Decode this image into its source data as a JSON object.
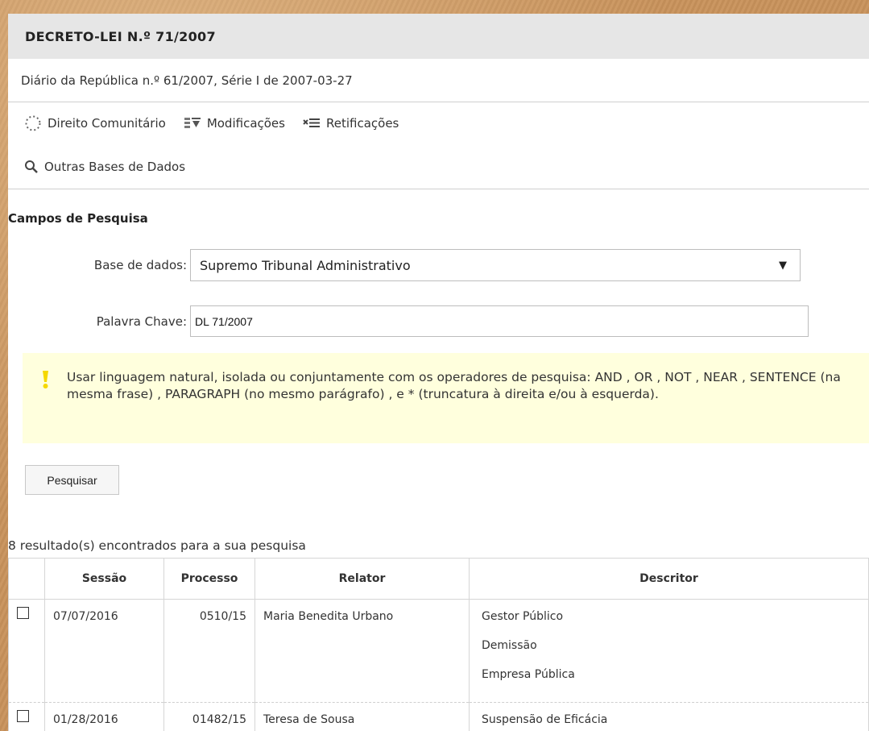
{
  "header": {
    "title": "DECRETO-LEI N.º 71/2007",
    "subtitle": "Diário da República n.º 61/2007, Série I de 2007-03-27"
  },
  "links": {
    "direito_comunitario": "Direito Comunitário",
    "modificacoes": "Modificações",
    "retificacoes": "Retificações",
    "outras_bases": "Outras Bases de Dados"
  },
  "search": {
    "section_title": "Campos de Pesquisa",
    "database_label": "Base de dados:",
    "database_value": "Supremo Tribunal Administrativo",
    "keyword_label": "Palavra Chave:",
    "keyword_value": "DL 71/2007",
    "notice_text": "Usar linguagem natural, isolada ou conjuntamente com os operadores de pesquisa: AND , OR , NOT , NEAR , SENTENCE (na mesma frase) , PARAGRAPH (no mesmo parágrafo) , e * (truncatura à direita e/ou à esquerda).",
    "button_label": "Pesquisar"
  },
  "results": {
    "count_text": "8 resultado(s) encontrados para a sua pesquisa",
    "columns": [
      "Sessão",
      "Processo",
      "Relator",
      "Descritor"
    ],
    "rows": [
      {
        "sessao": "07/07/2016",
        "processo": "0510/15",
        "relator": "Maria Benedita Urbano",
        "descritor": [
          "Gestor Público",
          "Demissão",
          "Empresa Pública"
        ]
      },
      {
        "sessao": "01/28/2016",
        "processo": "01482/15",
        "relator": "Teresa de Sousa",
        "descritor": [
          "Suspensão de Eficácia"
        ]
      }
    ]
  },
  "colors": {
    "notice_bg": "#ffffdd",
    "title_bar_bg": "#e6e6e6",
    "notice_icon": "#f5d800"
  }
}
